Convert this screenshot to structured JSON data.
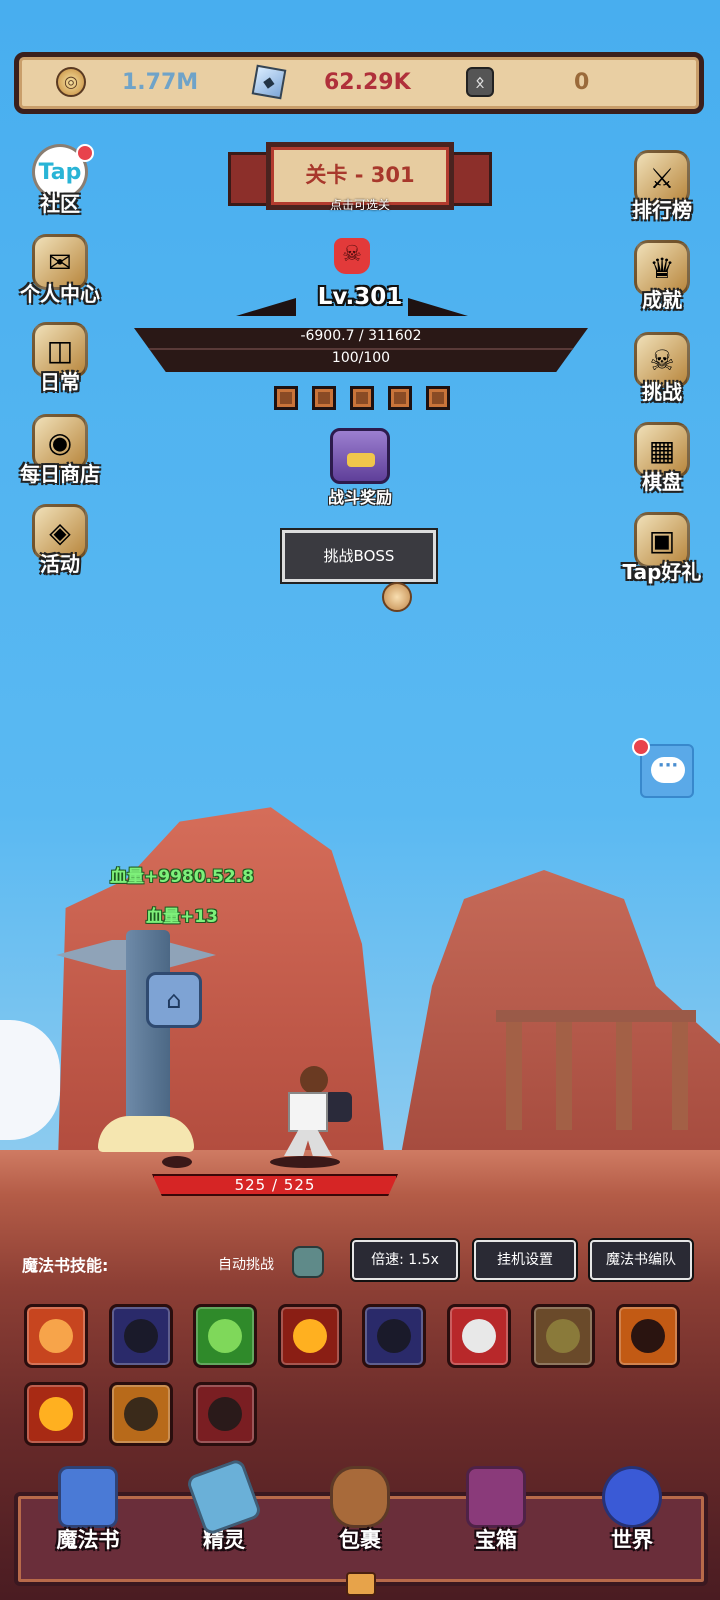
{
  "currency": {
    "gold": "1.77M",
    "crystal": "62.29K",
    "rune": "0",
    "gold_icon": "coin-icon",
    "crystal_icon": "crystal-icon",
    "rune_icon": "rune-icon",
    "gold_color": "#6fa3c8",
    "crystal_color": "#b0303a",
    "rune_color": "#9a6a3a"
  },
  "stage": {
    "title": "关卡 - 301",
    "hint": "点击可选关"
  },
  "left_menu": [
    {
      "label": "社区",
      "icon": "Tap",
      "badge": true
    },
    {
      "label": "个人中心",
      "icon": "✉"
    },
    {
      "label": "日常",
      "icon": "◫"
    },
    {
      "label": "每日商店",
      "icon": "◉"
    },
    {
      "label": "活动",
      "icon": "◈"
    }
  ],
  "right_menu": [
    {
      "label": "排行榜",
      "icon": "⚔"
    },
    {
      "label": "成就",
      "icon": "♛"
    },
    {
      "label": "挑战",
      "icon": "☠"
    },
    {
      "label": "棋盘",
      "icon": "▦"
    },
    {
      "label": "Tap好礼",
      "icon": "▣"
    }
  ],
  "boss": {
    "skull_icon": "☠",
    "level": "Lv.301",
    "hp": "-6900.7 / 311602",
    "shield": "100/100",
    "reward_label": "战斗奖励",
    "challenge_button": "挑战BOSS"
  },
  "battle": {
    "float_text_1": "血量+9980.52.8",
    "float_text_2": "血量+13",
    "hero_hp": "525 / 525"
  },
  "skills": {
    "label": "魔法书技能:",
    "auto_label": "自动挑战",
    "speed_button": "倍速: 1.5x",
    "idle_button": "挂机设置",
    "team_button": "魔法书编队",
    "items": [
      {
        "name": "fire-spirit-skill",
        "bg": "#c7451f",
        "fg": "#f7a44a"
      },
      {
        "name": "shadow-ghost-skill",
        "bg": "#2a2a6a",
        "fg": "#1a1a2a"
      },
      {
        "name": "poison-cloud-skill",
        "bg": "#2f8a2a",
        "fg": "#7fd85a"
      },
      {
        "name": "fireball-skill",
        "bg": "#8a1e14",
        "fg": "#ffb020"
      },
      {
        "name": "shadow-ghost-skill-2",
        "bg": "#2a2a6a",
        "fg": "#1a1a2a"
      },
      {
        "name": "hammer-skill",
        "bg": "#b8282a",
        "fg": "#e8e8e8"
      },
      {
        "name": "archer-skill",
        "bg": "#6a4a2a",
        "fg": "#8a7a3a"
      },
      {
        "name": "flame-bomb-skill",
        "bg": "#c25a14",
        "fg": "#2a1410"
      },
      {
        "name": "fireball-skill-2",
        "bg": "#a82a14",
        "fg": "#ffb020"
      },
      {
        "name": "target-skill",
        "bg": "#b86a1a",
        "fg": "#3a2a1a"
      },
      {
        "name": "dark-orb-skill",
        "bg": "#7a1e22",
        "fg": "#2a1a1a"
      }
    ]
  },
  "nav": [
    {
      "label": "魔法书",
      "color": "#4a7ad6"
    },
    {
      "label": "精灵",
      "color": "#6ab0d8"
    },
    {
      "label": "包裹",
      "color": "#a86a3a"
    },
    {
      "label": "宝箱",
      "color": "#8a3a7a"
    },
    {
      "label": "世界",
      "color": "#3a5ad6"
    }
  ]
}
